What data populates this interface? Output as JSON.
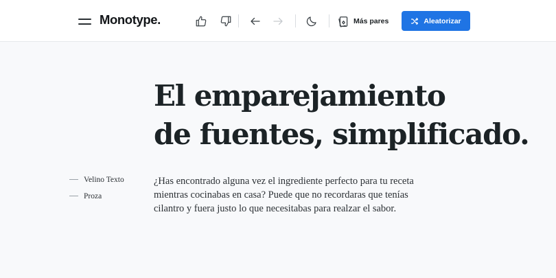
{
  "header": {
    "logo": "Monotype.",
    "more_pairs_label": "Más pares",
    "shuffle_label": "Aleatorizar",
    "accent_color": "#1f74e4",
    "icons": [
      "menu-icon",
      "thumbs-up-icon",
      "thumbs-down-icon",
      "arrow-left-icon",
      "arrow-right-icon",
      "moon-icon",
      "cards-icon",
      "shuffle-icon"
    ]
  },
  "main": {
    "headline_line1": "El emparejamiento",
    "headline_line2": "de fuentes, simplificado.",
    "body_line1": "¿Has encontrado alguna vez el ingrediente perfecto para tu receta",
    "body_line2": "mientras cocinabas en casa? Puede que no recordaras que tenías",
    "body_line3": "cilantro y fuera justo lo que necesitabas para realzar el sabor."
  },
  "fonts_legend": [
    {
      "label": "Velino Texto"
    },
    {
      "label": "Proza"
    }
  ]
}
